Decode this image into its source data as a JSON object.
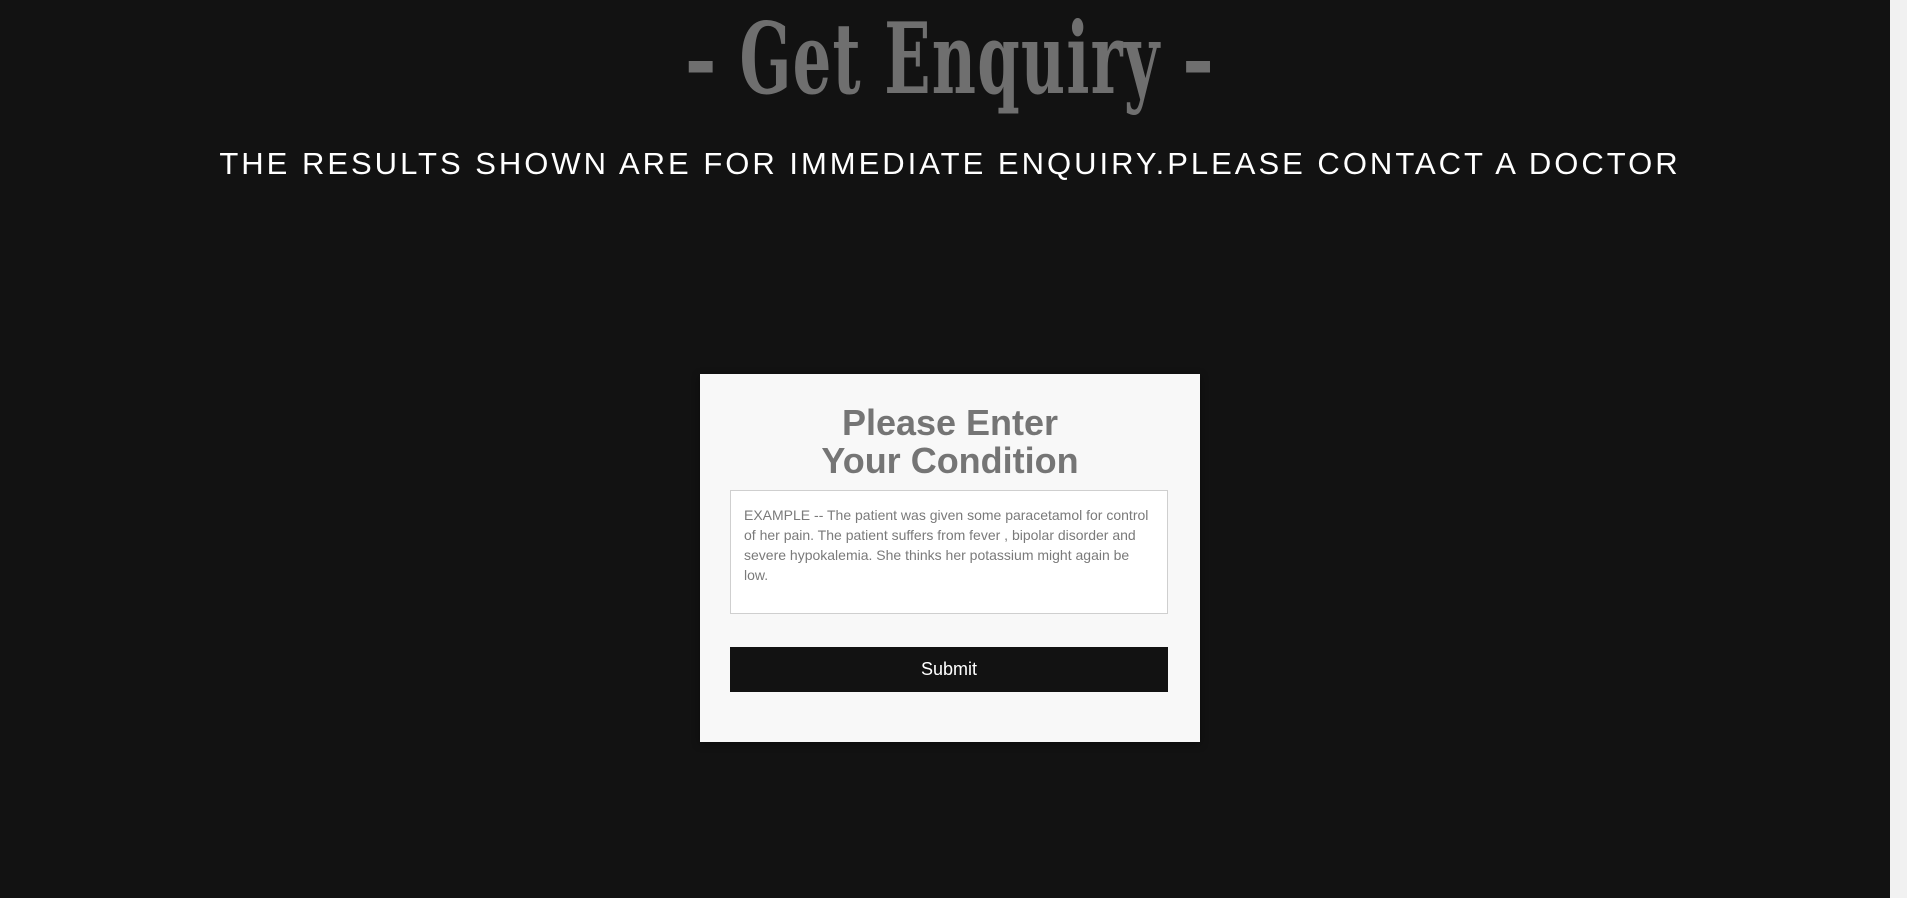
{
  "header": {
    "title": "– Get Enquiry –",
    "subtitle": "THE RESULTS SHOWN ARE FOR IMMEDIATE ENQUIRY.PLEASE CONTACT A DOCTOR"
  },
  "form": {
    "title": "Please Enter Your Condition",
    "input_placeholder": "EXAMPLE -- The patient was given some paracetamol for control of her pain. The patient suffers from fever , bipolar disorder and severe hypokalemia. She thinks her potassium might again be low.",
    "input_value": "",
    "submit_label": "Submit"
  },
  "colors": {
    "background": "#121212",
    "card": "#f8f8f8",
    "button": "#121212",
    "title_gray": "#6f6f6f"
  }
}
